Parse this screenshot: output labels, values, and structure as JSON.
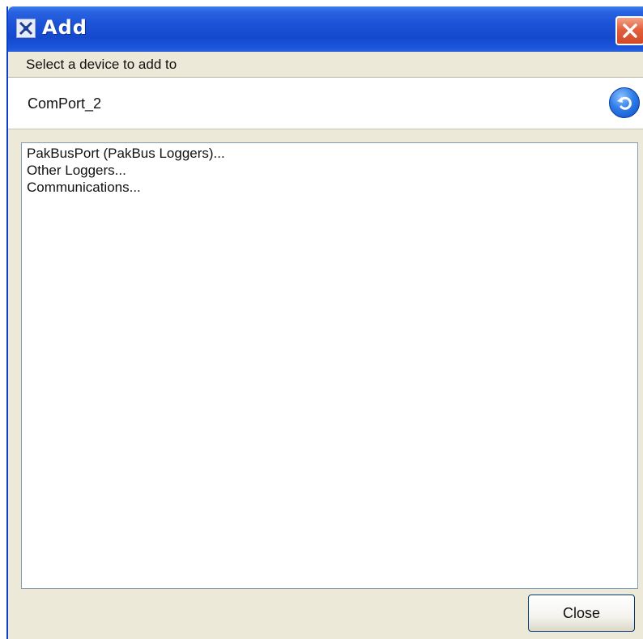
{
  "window": {
    "title": "Add",
    "icon": "app-icon",
    "close_icon": "close-x-icon"
  },
  "header": {
    "prompt": "Select a device to add to"
  },
  "device_bar": {
    "current_device": "ComPort_2",
    "back_icon": "back-arrow-icon"
  },
  "list": {
    "items": [
      "PakBusPort (PakBus Loggers)...",
      "Other Loggers...",
      "Communications..."
    ]
  },
  "footer": {
    "close_label": "Close"
  },
  "colors": {
    "titlebar": "#1549cd",
    "window_bg": "#ece9d8",
    "close_x": "#e3603d",
    "back_button": "#2f7de9"
  }
}
